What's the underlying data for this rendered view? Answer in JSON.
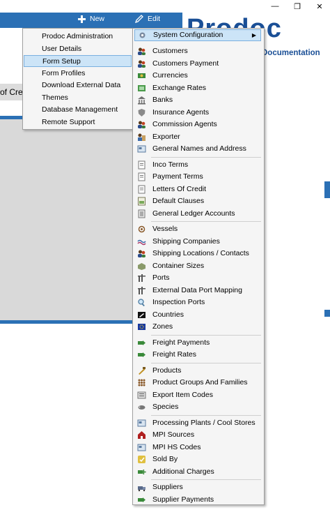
{
  "window": {
    "minimize": "—",
    "restore": "❐",
    "close": "✕"
  },
  "toolbar": {
    "new_label": "New",
    "edit_label": "Edit"
  },
  "logo": {
    "text": "Prodoc",
    "subtitle": "Documentation"
  },
  "background": {
    "partial_label": "of Cre"
  },
  "menu_primary": [
    {
      "label": "Prodoc Administration"
    },
    {
      "label": "User Details"
    },
    {
      "label": "Form Setup",
      "selected": true
    },
    {
      "label": "Form Profiles"
    },
    {
      "label": "Download External Data"
    },
    {
      "label": "Themes"
    },
    {
      "label": "Database Management"
    },
    {
      "label": "Remote Support"
    }
  ],
  "menu_system": {
    "header": "System Configuration",
    "items": [
      {
        "label": "Customers",
        "icon": "people-icon"
      },
      {
        "label": "Customers Payment",
        "icon": "people-icon"
      },
      {
        "label": "Currencies",
        "icon": "currency-icon"
      },
      {
        "label": "Exchange Rates",
        "icon": "exchange-icon"
      },
      {
        "label": "Banks",
        "icon": "bank-icon"
      },
      {
        "label": "Insurance Agents",
        "icon": "shield-icon"
      },
      {
        "label": "Commission Agents",
        "icon": "people-icon"
      },
      {
        "label": "Exporter",
        "icon": "exporter-icon"
      },
      {
        "label": "General Names and Address",
        "icon": "card-icon"
      },
      {
        "label": "Inco Terms",
        "icon": "document-icon"
      },
      {
        "label": "Payment Terms",
        "icon": "document-icon"
      },
      {
        "label": "Letters Of Credit",
        "icon": "document-icon"
      },
      {
        "label": "Default Clauses",
        "icon": "clauses-icon"
      },
      {
        "label": "General Ledger Accounts",
        "icon": "ledger-icon"
      },
      {
        "label": "Vessels",
        "icon": "vessel-icon"
      },
      {
        "label": "Shipping Companies",
        "icon": "ship-company-icon"
      },
      {
        "label": "Shipping Locations / Contacts",
        "icon": "people-icon"
      },
      {
        "label": "Container Sizes",
        "icon": "container-icon"
      },
      {
        "label": "Ports",
        "icon": "port-icon"
      },
      {
        "label": "External Data Port Mapping",
        "icon": "port-icon"
      },
      {
        "label": "Inspection Ports",
        "icon": "search-icon"
      },
      {
        "label": "Countries",
        "icon": "flag-icon"
      },
      {
        "label": "Zones",
        "icon": "eu-flag-icon"
      },
      {
        "label": "Freight Payments",
        "icon": "freight-icon"
      },
      {
        "label": "Freight Rates",
        "icon": "freight-icon"
      },
      {
        "label": "Products",
        "icon": "product-icon"
      },
      {
        "label": "Product Groups And Families",
        "icon": "grid-icon"
      },
      {
        "label": "Export Item Codes",
        "icon": "codes-icon"
      },
      {
        "label": "Species",
        "icon": "species-icon"
      },
      {
        "label": "Processing Plants / Cool Stores",
        "icon": "card-icon"
      },
      {
        "label": "MPI Sources",
        "icon": "barn-icon"
      },
      {
        "label": "MPI HS Codes",
        "icon": "card-icon"
      },
      {
        "label": "Sold By",
        "icon": "sold-icon"
      },
      {
        "label": "Additional Charges",
        "icon": "charges-icon"
      },
      {
        "label": "Suppliers",
        "icon": "supplier-icon"
      },
      {
        "label": "Supplier Payments",
        "icon": "freight-icon"
      }
    ]
  }
}
